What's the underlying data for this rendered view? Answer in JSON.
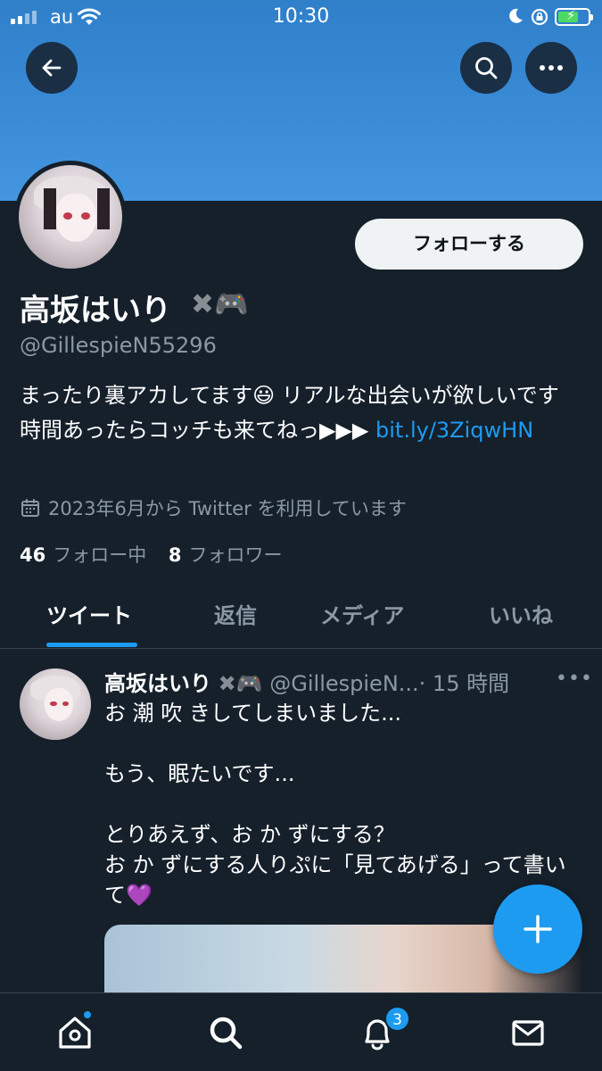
{
  "status_bar": {
    "carrier": "au",
    "time": "10:30"
  },
  "profile": {
    "display_name": "高坂はいり",
    "name_emoji": "🎮",
    "handle": "@GillespieN55296",
    "follow_label": "フォローする",
    "bio_text": "まったり裏アカしてます😃 リアルな出会いが欲しいです 時間あったらコッチも来てねっ▶▶▶ ",
    "bio_link": "bit.ly/3ZiqwHN",
    "joined": "2023年6月から Twitter を利用しています",
    "following_count": "46",
    "following_label": "フォロー中",
    "followers_count": "8",
    "followers_label": "フォロワー"
  },
  "tabs": [
    {
      "label": "ツイート",
      "active": true
    },
    {
      "label": "返信",
      "active": false
    },
    {
      "label": "メディア",
      "active": false
    },
    {
      "label": "いいね",
      "active": false
    }
  ],
  "tweet": {
    "name": "高坂はいり",
    "emoji": "🎮",
    "handle": "@GillespieN...",
    "time": "· 15 時間",
    "text": "お 潮 吹 きしてしまいました...\n\nもう、眠たいです...\n\nとりあえず、お か ずにする？\nお か ずにする人りぷに「見てあげる」って書いて💜"
  },
  "bottom_nav": {
    "notification_badge": "3"
  },
  "colors": {
    "background": "#15202b",
    "accent": "#1d9bf0",
    "secondary_text": "#8b98a5",
    "divider": "#38444d"
  },
  "icons": [
    "back-arrow-icon",
    "search-icon",
    "more-icon",
    "calendar-icon",
    "home-icon",
    "search-nav-icon",
    "bell-icon",
    "mail-icon",
    "compose-plus-icon"
  ]
}
